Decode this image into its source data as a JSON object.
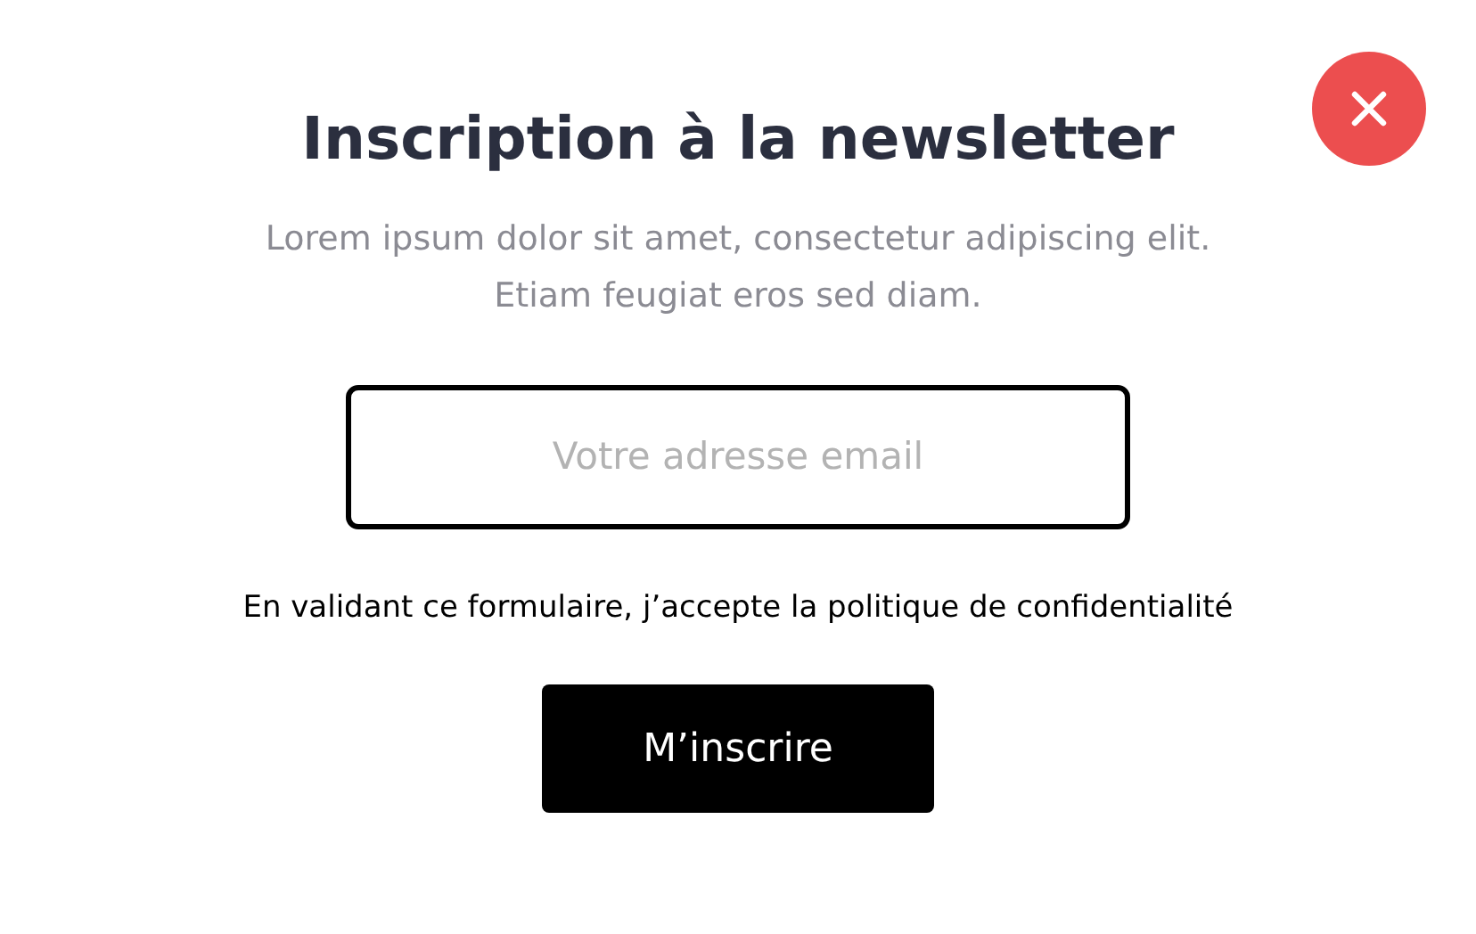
{
  "title": "Inscription à la newsletter",
  "description": "Lorem ipsum dolor sit amet, consectetur adipiscing elit. Etiam feugiat eros sed diam.",
  "email_field": {
    "placeholder": "Votre adresse email"
  },
  "consent": "En validant ce formulaire, j’accepte la politique de confidentialité",
  "submit_button": "M’inscrire"
}
